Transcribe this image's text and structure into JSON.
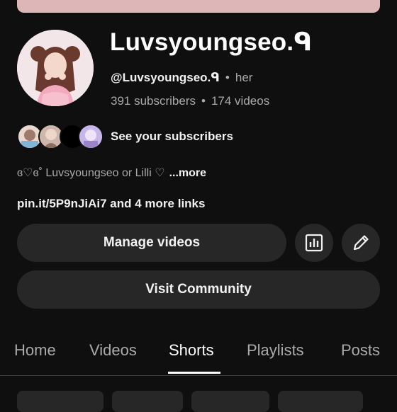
{
  "channel": {
    "name": "Luvsyoungseo.ᑫ",
    "handle": "@Luvsyoungseo.ᑫ",
    "pronouns": "her",
    "subscribers": "391 subscribers",
    "videos": "174 videos"
  },
  "subscribers_row": {
    "label": "See your subscribers"
  },
  "bio": {
    "text": "ɞ♡ɞ˚ Luvsyoungseo or Lilli ♡",
    "more": "...more"
  },
  "links": {
    "text": "pin.it/5P9nJiAi7 and 4 more links"
  },
  "actions": {
    "manage": "Manage videos",
    "community": "Visit Community",
    "analytics_icon": "analytics-icon",
    "edit_icon": "pencil-icon"
  },
  "tabs": [
    {
      "label": "Home"
    },
    {
      "label": "Videos"
    },
    {
      "label": "Shorts"
    },
    {
      "label": "Playlists"
    },
    {
      "label": "Posts"
    }
  ],
  "active_tab": "Shorts",
  "colors": {
    "background": "#0f0f0f",
    "surface": "#272727",
    "banner": "#ddb6b8",
    "muted_text": "#aaaaaa"
  }
}
